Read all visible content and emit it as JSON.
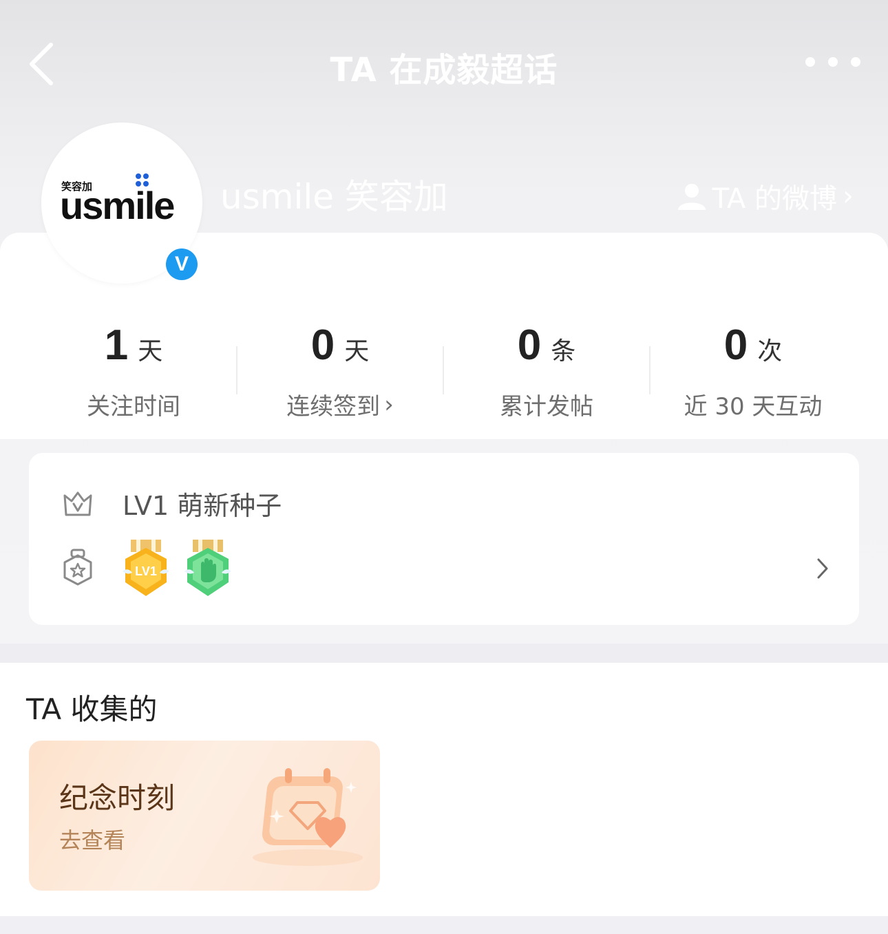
{
  "nav": {
    "title": "TA 在成毅超话",
    "back_icon": "back-arrow-icon",
    "more_icon": "more-dots-icon"
  },
  "profile": {
    "avatar_logo_small": "笑容加",
    "avatar_logo_main": "usmile",
    "verified_mark": "V",
    "name": "usmile 笑容加",
    "weibo_link": "TA 的微博",
    "weibo_link_arrow": "›"
  },
  "stats": [
    {
      "value": "1",
      "unit": "天",
      "label": "关注时间"
    },
    {
      "value": "0",
      "unit": "天",
      "label": "连续签到",
      "arrow": "›"
    },
    {
      "value": "0",
      "unit": "条",
      "label": "累计发帖"
    },
    {
      "value": "0",
      "unit": "次",
      "label": "近 30 天互动"
    }
  ],
  "level": {
    "text": "LV1 萌新种子",
    "level_icon": "crown-v-icon",
    "badge_icon": "badge-star-icon",
    "medals": [
      {
        "name": "lv1-medal",
        "text": "LV1",
        "color": "#f7b21c"
      },
      {
        "name": "hand-medal",
        "color": "#4fcf7a"
      }
    ]
  },
  "collect": {
    "title": "TA 收集的",
    "card": {
      "title": "纪念时刻",
      "sub": "去查看"
    }
  },
  "colors": {
    "accent_blue": "#1d9bf0",
    "card_title_brown": "#5a3518",
    "card_sub_brown": "#b48458"
  }
}
